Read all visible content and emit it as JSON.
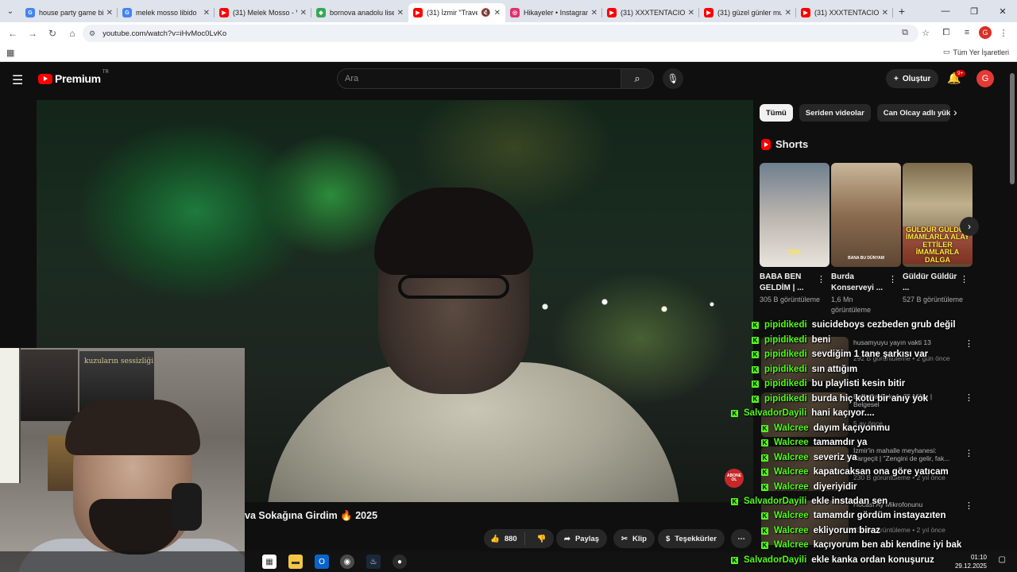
{
  "browser": {
    "tabs": [
      {
        "title": "house party game bi",
        "fav_color": "#4285f4",
        "fav_glyph": "G"
      },
      {
        "title": "melek mosso libido",
        "fav_color": "#4285f4",
        "fav_glyph": "G"
      },
      {
        "title": "(31) Melek Mosso - V",
        "fav_color": "#ff0000",
        "fav_glyph": "▶"
      },
      {
        "title": "bornova anadolu lise",
        "fav_color": "#34a853",
        "fav_glyph": "◆"
      },
      {
        "title": "(31) İzmir \"Trave:",
        "fav_color": "#ff0000",
        "fav_glyph": "▶"
      },
      {
        "title": "Hikayeler • Instagram",
        "fav_color": "#e1306c",
        "fav_glyph": "◎"
      },
      {
        "title": "(31) XXXTENTACION",
        "fav_color": "#ff0000",
        "fav_glyph": "▶"
      },
      {
        "title": "(31) güzel günler mu",
        "fav_color": "#ff0000",
        "fav_glyph": "▶"
      },
      {
        "title": "(31) XXXTENTACION",
        "fav_color": "#ff0000",
        "fav_glyph": "▶"
      }
    ],
    "url": "youtube.com/watch?v=iHvMoc0LvKo",
    "bookmarks_all": "Tüm Yer İşaretleri"
  },
  "yt": {
    "brand": "Premium",
    "country": "TR",
    "search_placeholder": "Ara",
    "create_label": "Oluştur",
    "notif_count": "9+",
    "avatar_letter": "G"
  },
  "video": {
    "title_partial": "va Sokağına Girdim 🔥 2025",
    "abone_badge": "ABONE OL",
    "likes": "880",
    "share": "Paylaş",
    "clip": "Klip",
    "thanks": "Teşekkürler"
  },
  "webcam": {
    "poster_text": "kuzuların sessizliği"
  },
  "sidebar": {
    "chips": [
      "Tümü",
      "Seriden videolar",
      "Can Olcay adlı yükley"
    ],
    "shorts_label": "Shorts",
    "shorts": [
      {
        "title": "BABA BEN GELDİM | ...",
        "views": "305 B görüntüleme",
        "caption": "Olih"
      },
      {
        "title": "Burda Konserveyi ...",
        "views": "1,6 Mn görüntüleme",
        "caption": "BANA BU DÜNYAM"
      },
      {
        "title": "Güldür Güldür ...",
        "views": "527 B görüntüleme",
        "caption": "GÜLDÜR GÜLDÜR İMAMLARLA ALAY ETTİLER İMAMLARLA DALGA"
      }
    ],
    "related": [
      {
        "title": "husamyuyu yayın vakti 13",
        "meta": "292 B görüntüleme • 2 gün önce"
      },
      {
        "title": "Bornova Sokağı 35 Milim | Belgesel",
        "meta": "5 ay önce"
      },
      {
        "title": "İzmir'in mahalle meyhanesi: Vargeçit | \"Zengini de gelir, fak...",
        "meta": "230 B görüntüleme • 2 yıl önce"
      },
      {
        "title": "Hocası Ay Mikrofonunu",
        "meta": "230 B görüntüleme • 2 yıl önce"
      }
    ]
  },
  "chat": [
    {
      "user": "pipidikedi",
      "msg": "suicideboys cezbeden grub değil"
    },
    {
      "user": "pipidikedi",
      "msg": "beni"
    },
    {
      "user": "pipidikedi",
      "msg": "sevdiğim 1 tane şarkısı var"
    },
    {
      "user": "pipidikedi",
      "msg": "sın attığım"
    },
    {
      "user": "pipidikedi",
      "msg": "bu playlisti kesin bitir"
    },
    {
      "user": "pipidikedi",
      "msg": "burda hiç kötü bir anıy yok"
    },
    {
      "user": "SalvadorDayili",
      "msg": "hani kaçıyor...."
    },
    {
      "user": "Walcree",
      "msg": "dayım kaçıyonmu"
    },
    {
      "user": "Walcree",
      "msg": "tamamdır ya"
    },
    {
      "user": "Walcree",
      "msg": "severiz ya"
    },
    {
      "user": "Walcree",
      "msg": "kapatıcaksan ona göre yatıcam"
    },
    {
      "user": "Walcree",
      "msg": "diyeriyidir"
    },
    {
      "user": "SalvadorDayili",
      "msg": "ekle instadan sen"
    },
    {
      "user": "Walcree",
      "msg": "tamamdır gördüm instayazıten"
    },
    {
      "user": "Walcree",
      "msg": "ekliyorum biraz"
    },
    {
      "user": "Walcree",
      "msg": "kaçıyorum ben abi kendine iyi bak"
    },
    {
      "user": "SalvadorDayili",
      "msg": "ekle kanka ordan konuşuruz"
    }
  ],
  "taskbar": {
    "time": "01:10",
    "date": "29.12.2025"
  }
}
